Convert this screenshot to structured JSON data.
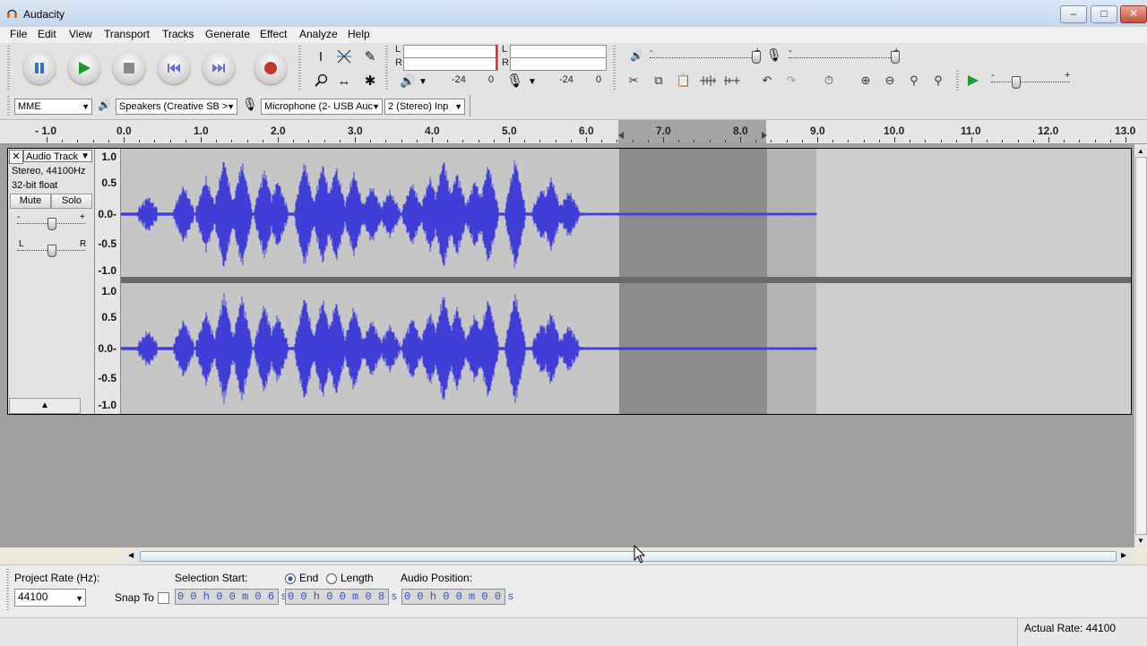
{
  "window": {
    "title": "Audacity"
  },
  "menu": [
    "File",
    "Edit",
    "View",
    "Transport",
    "Tracks",
    "Generate",
    "Effect",
    "Analyze",
    "Help"
  ],
  "meters": {
    "l": "L",
    "r": "R",
    "playback_db": "-24",
    "playback_zero": "0",
    "record_db": "-24",
    "record_zero": "0"
  },
  "device": {
    "host": "MME",
    "speakers": "Speakers (Creative SB >",
    "microphone": "Microphone (2- USB Auc",
    "channels": "2 (Stereo) Inp"
  },
  "ruler": [
    "- 1.0",
    "0.0",
    "1.0",
    "2.0",
    "3.0",
    "4.0",
    "5.0",
    "6.0",
    "7.0",
    "8.0",
    "9.0",
    "10.0",
    "11.0",
    "12.0",
    "13.0"
  ],
  "track": {
    "name": "Audio Track",
    "info1": "Stereo, 44100Hz",
    "info2": "32-bit float",
    "mute": "Mute",
    "solo": "Solo",
    "pan_l": "L",
    "pan_r": "R",
    "gain_minus": "-",
    "gain_plus": "+"
  },
  "vscale": [
    "1.0",
    "0.5",
    "0.0-",
    "-0.5",
    "-1.0"
  ],
  "selection": {
    "project_rate_label": "Project Rate (Hz):",
    "project_rate": "44100",
    "snap_label": "Snap To",
    "start_label": "Selection Start:",
    "end_label": "End",
    "length_label": "Length",
    "position_label": "Audio Position:",
    "start_value": "0 0 h 0 0 m 0 6 s",
    "end_value": "0 0 h 0 0 m 0 8 s",
    "position_value": "0 0 h 0 0 m 0 0 s"
  },
  "status": {
    "actual_rate": "Actual Rate: 44100"
  },
  "colors": {
    "waveform": "#3f3fd8",
    "selection": "#8c8c8c",
    "unselected_bg": "#cfcfcf"
  }
}
